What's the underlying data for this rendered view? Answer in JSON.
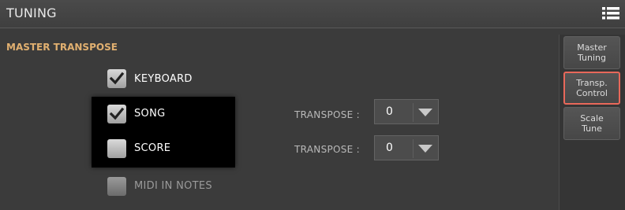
{
  "header": {
    "title": "TUNING",
    "menu_icon": "list-icon"
  },
  "section": {
    "title": "MASTER TRANSPOSE"
  },
  "rows": [
    {
      "label": "KEYBOARD",
      "checked": true,
      "enabled": true
    },
    {
      "label": "SONG",
      "checked": true,
      "enabled": true
    },
    {
      "label": "SCORE",
      "checked": false,
      "enabled": true
    },
    {
      "label": "MIDI IN NOTES",
      "checked": false,
      "enabled": false
    }
  ],
  "transpose": [
    {
      "label": "TRANSPOSE :",
      "value": "0"
    },
    {
      "label": "TRANSPOSE :",
      "value": "0"
    }
  ],
  "sidebar": {
    "tabs": [
      {
        "line1": "Master",
        "line2": "Tuning",
        "active": false
      },
      {
        "line1": "Transp.",
        "line2": "Control",
        "active": true
      },
      {
        "line1": "Scale",
        "line2": "Tune",
        "active": false
      }
    ]
  },
  "colors": {
    "accent": "#e1b070",
    "active_tab_border": "#e8685a",
    "checkmark": "#222222"
  }
}
